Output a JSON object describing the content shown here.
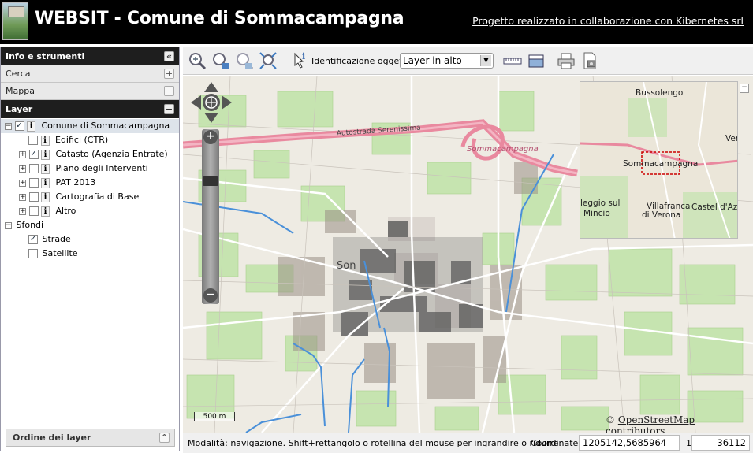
{
  "header": {
    "title": "WEBSIT - Comune di Sommacampagna",
    "link": "Progetto realizzato in collaborazione con Kibernetes srl"
  },
  "sidebar": {
    "info_panel": "Info e strumenti",
    "search_panel": "Cerca",
    "map_panel": "Mappa",
    "layer_panel": "Layer",
    "order_panel": "Ordine dei layer",
    "tree": [
      {
        "label": "Comune di Sommacampagna",
        "checked": true,
        "expander": "-",
        "info": true
      },
      {
        "label": "Edifici (CTR)",
        "checked": false,
        "info": true
      },
      {
        "label": "Catasto (Agenzia Entrate)",
        "checked": true,
        "expander": "+",
        "info": true
      },
      {
        "label": "Piano degli Interventi",
        "checked": false,
        "expander": "+",
        "info": true
      },
      {
        "label": "PAT 2013",
        "checked": false,
        "expander": "+",
        "info": true
      },
      {
        "label": "Cartografia di Base",
        "checked": false,
        "expander": "+",
        "info": true
      },
      {
        "label": "Altro",
        "checked": false,
        "expander": "+",
        "info": true
      },
      {
        "label": "Sfondi",
        "expander": "-"
      },
      {
        "label": "Strade",
        "checked": true,
        "radio": true
      },
      {
        "label": "Satellite",
        "checked": false,
        "radio": true
      }
    ]
  },
  "toolbar": {
    "identify_label": "Identificazione oggetti:",
    "identify_value": "Layer in alto",
    "tool_icons": [
      "zoom-in-icon",
      "zoom-out-icon",
      "zoom-back-icon",
      "zoom-extent-icon",
      "identify-icon",
      "measure-icon",
      "measure-area-icon",
      "print-icon",
      "export-icon"
    ]
  },
  "map": {
    "labels": {
      "motorway": "Autostrada Serenissima",
      "town": "Sommacampagna",
      "town_short": "Son",
      "ovv_bussolengo": "Bussolengo",
      "ovv_verona": "Ver",
      "ovv_town": "Sommacampagna",
      "ovv_vl1": "leggio sul",
      "ovv_vl2": "Mincio",
      "ovv_villa1": "Villafranca",
      "ovv_villa2": "di Verona",
      "ovv_castel": "Castel d'Azza"
    },
    "scalebar": "500 m",
    "attribution_prefix": "© ",
    "attribution_link": "OpenStreetMap",
    "attribution_suffix": " contributors"
  },
  "status": {
    "mode": "Modalità: navigazione. Shift+rettangolo o rotellina del mouse per ingrandire o ridurre.",
    "coord_label": "Coordinate:",
    "coordinates": "1205142,5685964",
    "scale_label": "1:",
    "scale": "36112"
  },
  "colors": {
    "header_bg": "#000000",
    "panel_head": "#1e1e1e",
    "motorway": "#e8839a",
    "green": "#c6e6b0",
    "water": "#4a90d9"
  }
}
